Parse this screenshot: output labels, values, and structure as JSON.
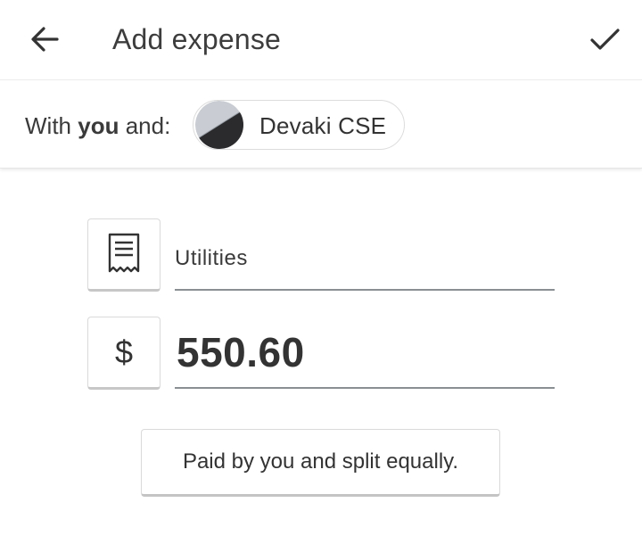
{
  "header": {
    "title": "Add expense",
    "back_icon": "arrow-left-icon",
    "save_icon": "checkmark-icon"
  },
  "with_bar": {
    "prefix": "With ",
    "you": "you",
    "suffix": " and:",
    "participant": {
      "name": "Devaki CSE",
      "avatar_colors": [
        "#c9ccd2",
        "#2b2b2e"
      ]
    }
  },
  "form": {
    "category_icon": "receipt-icon",
    "description": "Utilities",
    "currency_symbol": "$",
    "amount": "550.60"
  },
  "split": {
    "label": "Paid by you and split equally."
  }
}
